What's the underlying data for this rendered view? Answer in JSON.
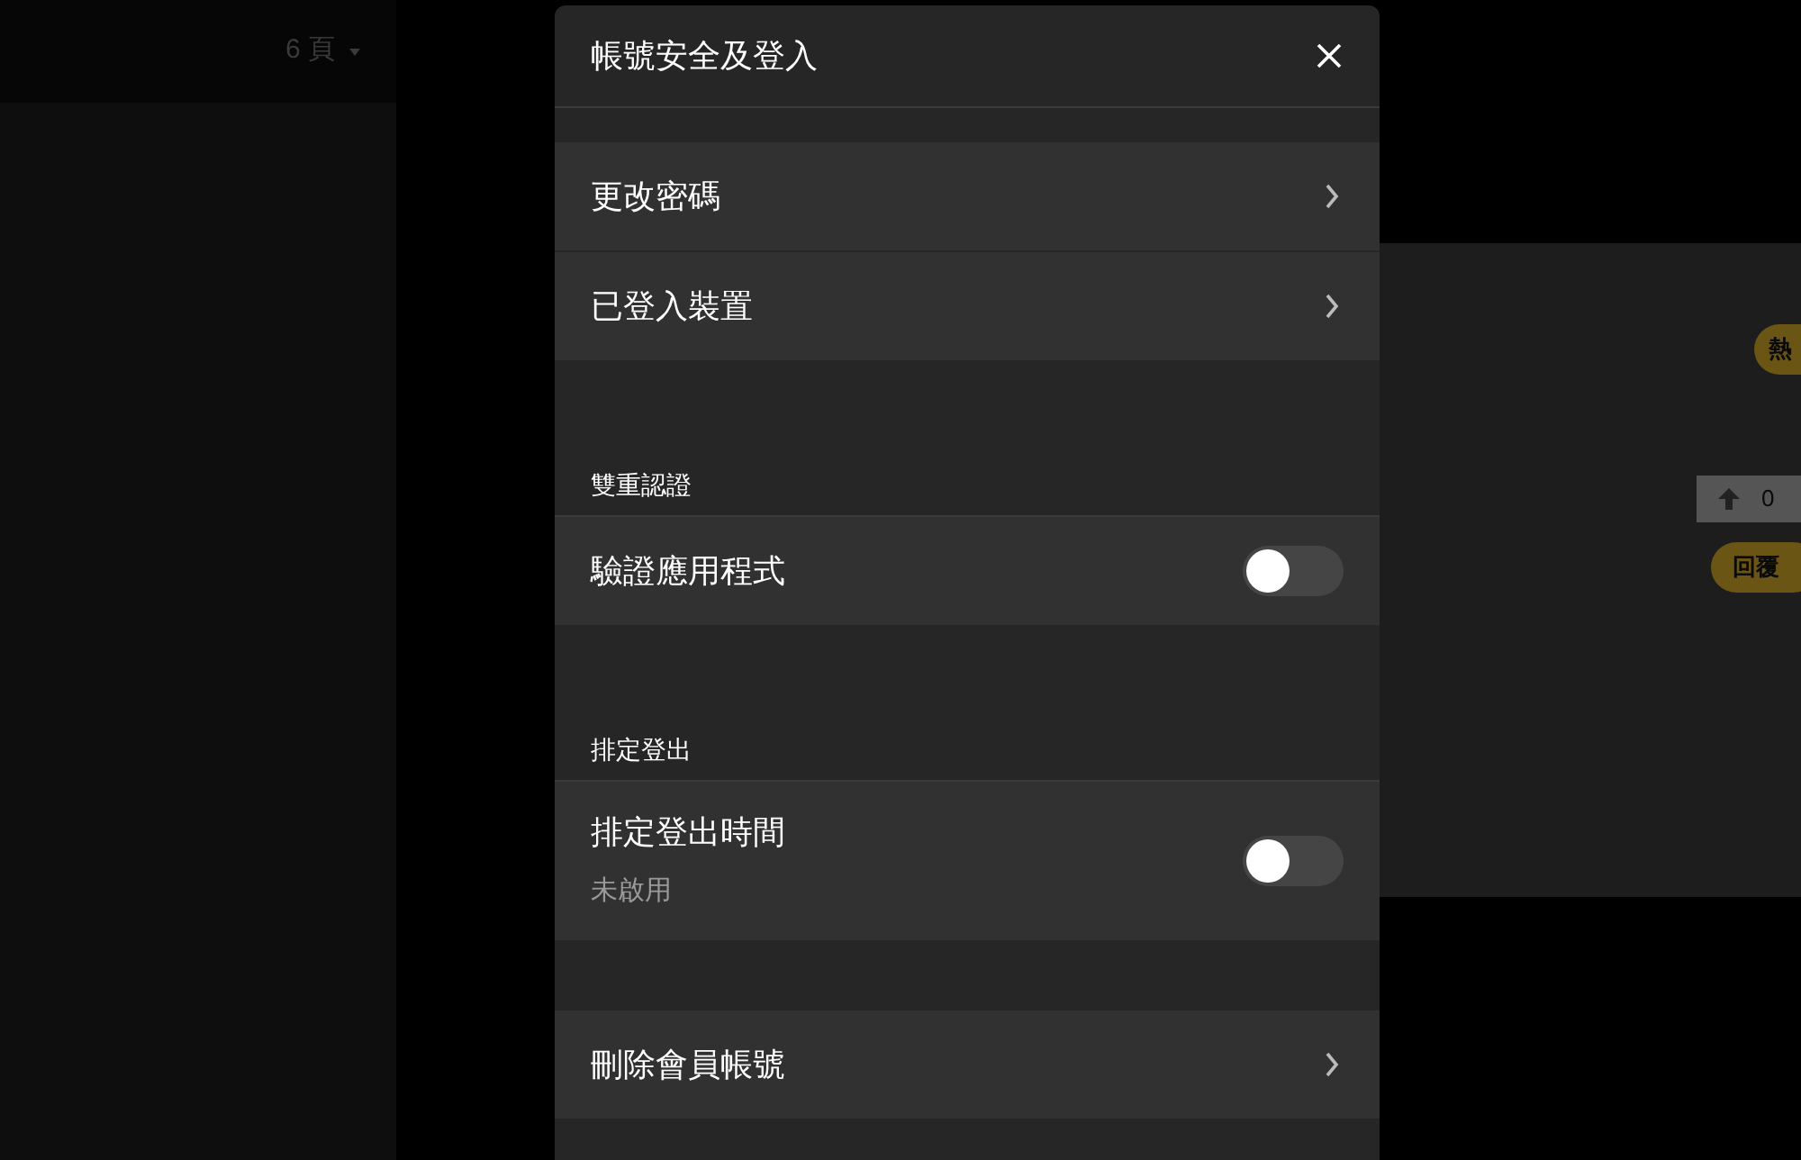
{
  "background": {
    "left_panel": {
      "page_selector": "6 頁"
    },
    "right_panel": {
      "hot_tag": "熱",
      "vote_count": "0",
      "reply_button": "回覆"
    }
  },
  "dialog": {
    "title": "帳號安全及登入",
    "sections": [
      {
        "items": [
          {
            "kind": "link",
            "label": "更改密碼"
          },
          {
            "kind": "link",
            "label": "已登入裝置"
          }
        ]
      },
      {
        "header": "雙重認證",
        "items": [
          {
            "kind": "toggle",
            "label": "驗證應用程式",
            "on": false
          }
        ]
      },
      {
        "header": "排定登出",
        "items": [
          {
            "kind": "toggle",
            "label": "排定登出時間",
            "subtitle": "未啟用",
            "on": false
          }
        ]
      },
      {
        "items": [
          {
            "kind": "link",
            "label": "刪除會員帳號"
          }
        ]
      }
    ]
  }
}
